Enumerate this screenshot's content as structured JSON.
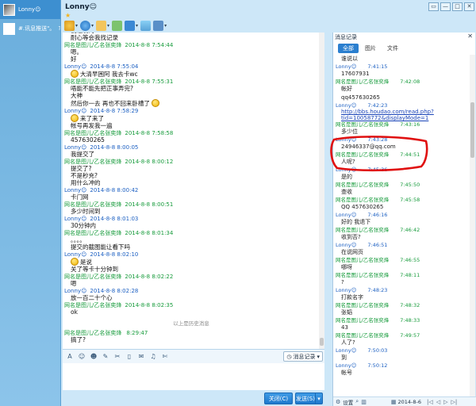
{
  "contacts": [
    {
      "name": "Lonny☺",
      "active": true
    },
    {
      "name": "#.讯息推送\"。",
      "suffix": "?",
      "active": false
    }
  ],
  "window": {
    "title": "Lonny☺",
    "controls": [
      "▭",
      "—",
      "□",
      "✕"
    ]
  },
  "chat": {
    "messages": [
      {
        "who": "",
        "time": "",
        "lines": [
          {
            "text": "我越发的"
          },
          {
            "text": "耐心等会我找记录"
          }
        ]
      },
      {
        "who": "网名是图儿/乙名张奕烽",
        "time": "2014-8-8 7:54:44",
        "me": false,
        "lines": [
          {
            "text": "嗯。"
          },
          {
            "text": "好"
          }
        ]
      },
      {
        "who": "Lonny☺",
        "time": "2014-8-8 7:55:04",
        "me": true,
        "lines": [
          {
            "text": "大清早困阿 我去卡wc",
            "emo": true
          }
        ]
      },
      {
        "who": "网名是图儿/乙名张奕烽",
        "time": "2014-8-8 7:55:31",
        "me": false,
        "lines": [
          {
            "text": "唔能不能先把正事弄完?"
          },
          {
            "text": "大神"
          },
          {
            "text": "然后你一去 再也不回来卧槽了",
            "emo_end": true
          }
        ]
      },
      {
        "who": "Lonny☺",
        "time": "2014-8-8 7:58:29",
        "me": true,
        "lines": [
          {
            "text": "来了来了",
            "emo": true
          },
          {
            "text": "帐号再发我一遍"
          }
        ]
      },
      {
        "who": "网名是图儿/乙名张奕烽",
        "time": "2014-8-8 7:58:58",
        "me": false,
        "lines": [
          {
            "text": "457630265"
          }
        ]
      },
      {
        "who": "Lonny☺",
        "time": "2014-8-8 8:00:05",
        "me": true,
        "lines": [
          {
            "text": "我提交了"
          }
        ]
      },
      {
        "who": "网名是图儿/乙名张奕烽",
        "time": "2014-8-8 8:00:12",
        "me": false,
        "lines": [
          {
            "text": "提交了?"
          },
          {
            "text": "不是秒充?"
          },
          {
            "text": "用什么冲的"
          }
        ]
      },
      {
        "who": "Lonny☺",
        "time": "2014-8-8 8:00:42",
        "me": true,
        "lines": [
          {
            "text": "卡门网"
          }
        ]
      },
      {
        "who": "网名是图儿/乙名张奕烽",
        "time": "2014-8-8 8:00:51",
        "me": false,
        "lines": [
          {
            "text": "多少时间到"
          }
        ]
      },
      {
        "who": "Lonny☺",
        "time": "2014-8-8 8:01:03",
        "me": true,
        "lines": [
          {
            "text": "30分钟内"
          }
        ]
      },
      {
        "who": "网名是图儿/乙名张奕烽",
        "time": "2014-8-8 8:01:34",
        "me": false,
        "lines": [
          {
            "text": "。。。。"
          },
          {
            "text": "提交的截图能让看下吗"
          }
        ]
      },
      {
        "who": "Lonny☺",
        "time": "2014-8-8 8:02:10",
        "me": true,
        "lines": [
          {
            "text": "是说",
            "emo": true
          },
          {
            "text": "关了等卡十分钟到"
          }
        ]
      },
      {
        "who": "网名是图儿/乙名张奕烽",
        "time": "2014-8-8 8:02:22",
        "me": false,
        "lines": [
          {
            "text": "嗯"
          }
        ]
      },
      {
        "who": "Lonny☺",
        "time": "2014-8-8 8:02:28",
        "me": true,
        "lines": [
          {
            "text": "放一百二十个心"
          }
        ]
      },
      {
        "who": "网名是图儿/乙名张奕烽",
        "time": "2014-8-8 8:02:35",
        "me": false,
        "lines": [
          {
            "text": "ok"
          }
        ]
      }
    ],
    "divider": "以上是历史消息",
    "last": {
      "who": "网名是图儿/乙名张奕烽",
      "time": "8:29:47",
      "text": "搞了?"
    }
  },
  "input_toolbar": {
    "icons": [
      "font-icon",
      "emoji-icon",
      "wink-icon",
      "scissors-icon",
      "voice-icon",
      "edit-icon",
      "image-icon",
      "music-icon",
      "tools-icon"
    ],
    "glyphs": [
      "A",
      "☺",
      "☻",
      "✎",
      "✂",
      "▯",
      "✉",
      "♫",
      "✄"
    ],
    "history_label": "消息记录",
    "history_dd": "▾"
  },
  "bottom": {
    "close_label": "关闭(C)",
    "send_label": "发送(S)",
    "send_dd": "▾"
  },
  "history": {
    "title": "消息记录",
    "close": "✕",
    "tabs": [
      "全部",
      "图片",
      "文件"
    ],
    "items": [
      {
        "type": "body",
        "text": "谁说以"
      },
      {
        "type": "hdr",
        "who": "Lonny☺",
        "time": "7:41:15",
        "me": true
      },
      {
        "type": "body",
        "text": "17607931"
      },
      {
        "type": "hdr",
        "who": "网名是图儿/乙名张奕烽",
        "time": "7:42:08",
        "me": false
      },
      {
        "type": "body",
        "text": "帐好"
      },
      {
        "type": "body",
        "text": "qq457630265"
      },
      {
        "type": "hdr",
        "who": "Lonny☺",
        "time": "7:42:23",
        "me": true
      },
      {
        "type": "link",
        "text": "http://bbs.houdao.com/read.php?tid=10058772&displayMode=1"
      },
      {
        "type": "hdr",
        "who": "网名是图儿/乙名张奕烽",
        "time": "7:43:16",
        "me": false
      },
      {
        "type": "body",
        "text": "多少位"
      },
      {
        "type": "hdr",
        "who": "Lonny☺",
        "time": "7:43:28",
        "me": true
      },
      {
        "type": "body",
        "text": "24946337@qq.com"
      },
      {
        "type": "hdr",
        "who": "网名是图儿/乙名张奕烽",
        "time": "7:44:51",
        "me": false
      },
      {
        "type": "body",
        "text": "人呢?"
      },
      {
        "type": "hdr",
        "who": "Lonny☺",
        "time": "7:45:36",
        "me": true
      },
      {
        "type": "body",
        "text": "是的"
      },
      {
        "type": "hdr",
        "who": "网名是图儿/乙名张奕烽",
        "time": "7:45:50",
        "me": false
      },
      {
        "type": "body",
        "text": "查收"
      },
      {
        "type": "hdr",
        "who": "网名是图儿/乙名张奕烽",
        "time": "7:45:58",
        "me": false
      },
      {
        "type": "body",
        "text": "QQ 457630265"
      },
      {
        "type": "hdr",
        "who": "Lonny☺",
        "time": "7:46:16",
        "me": true
      },
      {
        "type": "body",
        "text": "好的 我退下"
      },
      {
        "type": "hdr",
        "who": "网名是图儿/乙名张奕烽",
        "time": "7:46:42",
        "me": false
      },
      {
        "type": "body",
        "text": "收到否?"
      },
      {
        "type": "hdr",
        "who": "Lonny☺",
        "time": "7:46:51",
        "me": true
      },
      {
        "type": "body",
        "text": "在说网页"
      },
      {
        "type": "hdr",
        "who": "网名是图儿/乙名张奕烽",
        "time": "7:46:55",
        "me": false
      },
      {
        "type": "body",
        "text": "哪呀"
      },
      {
        "type": "hdr",
        "who": "网名是图儿/乙名张奕烽",
        "time": "7:48:11",
        "me": false
      },
      {
        "type": "body",
        "text": "?"
      },
      {
        "type": "hdr",
        "who": "Lonny☺",
        "time": "7:48:23",
        "me": true
      },
      {
        "type": "body",
        "text": "打款名字"
      },
      {
        "type": "hdr",
        "who": "网名是图儿/乙名张奕烽",
        "time": "7:48:32",
        "me": false
      },
      {
        "type": "body",
        "text": "张韬"
      },
      {
        "type": "hdr",
        "who": "网名是图儿/乙名张奕烽",
        "time": "7:48:33",
        "me": false
      },
      {
        "type": "body",
        "text": "43"
      },
      {
        "type": "hdr",
        "who": "网名是图儿/乙名张奕烽",
        "time": "7:49:57",
        "me": false
      },
      {
        "type": "body",
        "text": "人了?"
      },
      {
        "type": "hdr",
        "who": "Lonny☺",
        "time": "7:50:03",
        "me": true
      },
      {
        "type": "body",
        "text": "到"
      },
      {
        "type": "hdr",
        "who": "Lonny☺",
        "time": "7:50:12",
        "me": true
      },
      {
        "type": "body",
        "text": "帐号"
      }
    ],
    "footer": {
      "settings": "设置",
      "date": "2014-8-6",
      "pager": [
        "|◁",
        "◁",
        "▷",
        "▷|"
      ]
    }
  }
}
